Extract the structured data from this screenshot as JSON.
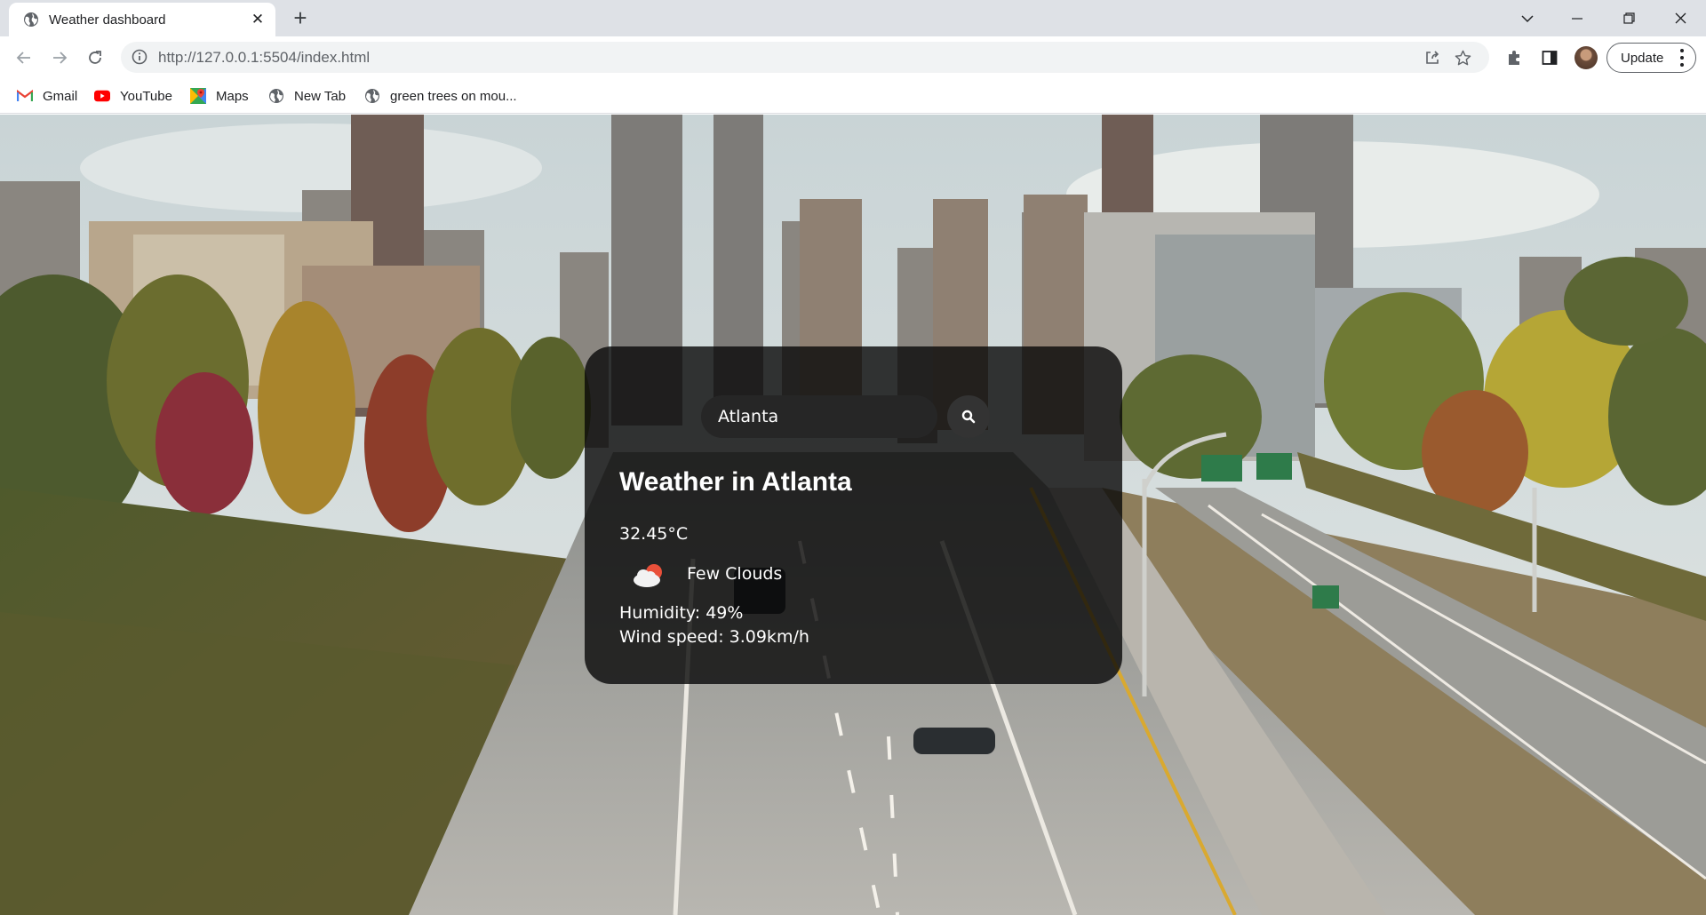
{
  "browser": {
    "tab": {
      "title": "Weather dashboard",
      "favicon": "globe-icon"
    },
    "address_bar": {
      "url": "http://127.0.0.1:5504/index.html"
    },
    "update_label": "Update",
    "bookmarks": [
      {
        "label": "Gmail",
        "icon": "gmail-icon"
      },
      {
        "label": "YouTube",
        "icon": "youtube-icon"
      },
      {
        "label": "Maps",
        "icon": "maps-icon"
      },
      {
        "label": "New Tab",
        "icon": "globe-icon"
      },
      {
        "label": "green trees on mou...",
        "icon": "globe-icon"
      }
    ]
  },
  "weather": {
    "search": {
      "value": "Atlanta",
      "placeholder": "Search"
    },
    "title": "Weather in Atlanta",
    "temperature": "32.45°C",
    "description": "Few Clouds",
    "condition_icon": "few-clouds-icon",
    "humidity": "Humidity: 49%",
    "wind": "Wind speed: 3.09km/h"
  },
  "background": {
    "subject": "city-skyline-highway-photo"
  }
}
